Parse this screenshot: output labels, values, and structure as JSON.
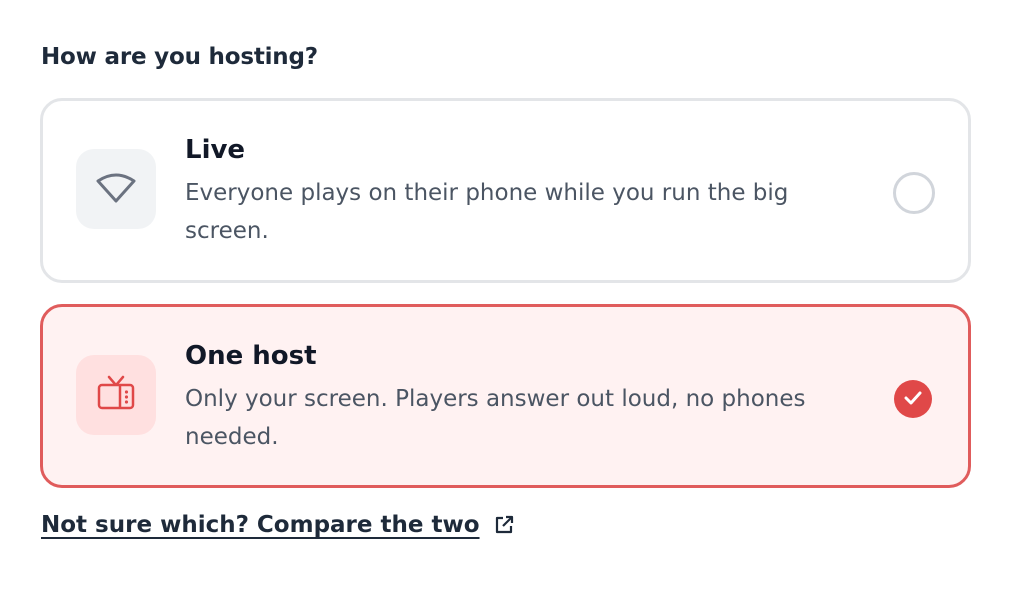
{
  "question": "How are you hosting?",
  "options": [
    {
      "title": "Live",
      "description": "Everyone plays on their phone while you run the big screen.",
      "icon": "wifi-icon",
      "selected": false
    },
    {
      "title": "One host",
      "description": "Only your screen. Players answer out loud, no phones needed.",
      "icon": "tv-icon",
      "selected": true
    }
  ],
  "compare_link": {
    "label": "Not sure which? Compare the two",
    "icon": "external-link-icon"
  },
  "colors": {
    "accent": "#e04848",
    "accent_bg": "#fff2f2",
    "neutral_border": "#e3e5e8"
  }
}
